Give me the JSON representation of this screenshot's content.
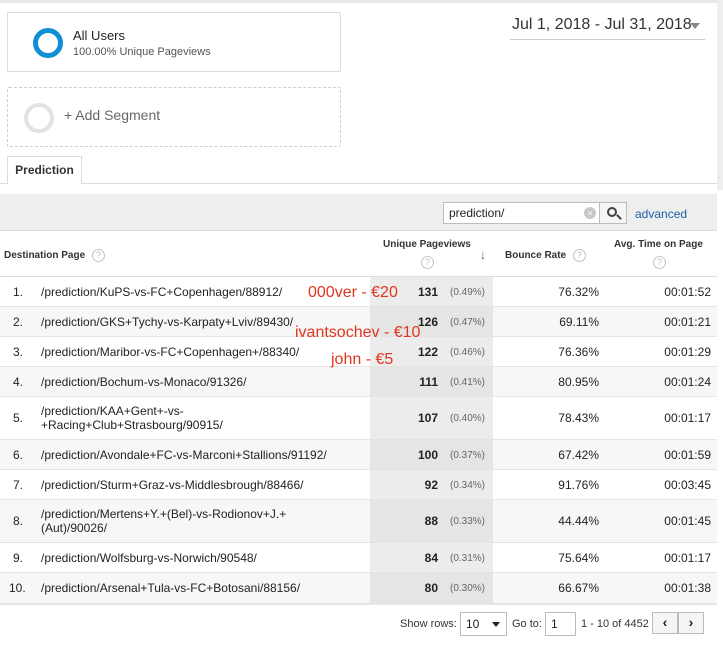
{
  "segments": {
    "active": {
      "title": "All Users",
      "subtitle": "100.00% Unique Pageviews",
      "color": "#0e8fd6"
    },
    "add_label": "+ Add Segment"
  },
  "date_range": {
    "label": "Jul 1, 2018 - Jul 31, 2018"
  },
  "tabs": [
    {
      "label": "Prediction",
      "selected": true
    }
  ],
  "filter": {
    "value": "prediction/",
    "advanced_label": "advanced"
  },
  "table": {
    "headers": {
      "page": "Destination Page",
      "unique_pageviews": "Unique Pageviews",
      "bounce_rate": "Bounce Rate",
      "avg_time": "Avg. Time on Page"
    },
    "sort": {
      "column": "unique_pageviews",
      "direction": "descending"
    },
    "rows": [
      {
        "num": "1.",
        "page": "/prediction/KuPS-vs-FC+Copenhagen/88912/",
        "pv": "131",
        "pct": "(0.49%)",
        "bounce": "76.32%",
        "avg": "00:01:52"
      },
      {
        "num": "2.",
        "page": "/prediction/GKS+Tychy-vs-Karpaty+Lviv/89430/",
        "pv": "126",
        "pct": "(0.47%)",
        "bounce": "69.11%",
        "avg": "00:01:21"
      },
      {
        "num": "3.",
        "page": "/prediction/Maribor-vs-FC+Copenhagen+/88340/",
        "pv": "122",
        "pct": "(0.46%)",
        "bounce": "76.36%",
        "avg": "00:01:29"
      },
      {
        "num": "4.",
        "page": "/prediction/Bochum-vs-Monaco/91326/",
        "pv": "111",
        "pct": "(0.41%)",
        "bounce": "80.95%",
        "avg": "00:01:24"
      },
      {
        "num": "5.",
        "page": "/prediction/KAA+Gent+-vs-+Racing+Club+Strasbourg/90915/",
        "pv": "107",
        "pct": "(0.40%)",
        "bounce": "78.43%",
        "avg": "00:01:17"
      },
      {
        "num": "6.",
        "page": "/prediction/Avondale+FC-vs-Marconi+Stallions/91192/",
        "pv": "100",
        "pct": "(0.37%)",
        "bounce": "67.42%",
        "avg": "00:01:59"
      },
      {
        "num": "7.",
        "page": "/prediction/Sturm+Graz-vs-Middlesbrough/88466/",
        "pv": "92",
        "pct": "(0.34%)",
        "bounce": "91.76%",
        "avg": "00:03:45"
      },
      {
        "num": "8.",
        "page": "/prediction/Mertens+Y.+(Bel)-vs-Rodionov+J.+(Aut)/90026/",
        "pv": "88",
        "pct": "(0.33%)",
        "bounce": "44.44%",
        "avg": "00:01:45"
      },
      {
        "num": "9.",
        "page": "/prediction/Wolfsburg-vs-Norwich/90548/",
        "pv": "84",
        "pct": "(0.31%)",
        "bounce": "75.64%",
        "avg": "00:01:17"
      },
      {
        "num": "10.",
        "page": "/prediction/Arsenal+Tula-vs-FC+Botosani/88156/",
        "pv": "80",
        "pct": "(0.30%)",
        "bounce": "66.67%",
        "avg": "00:01:38"
      }
    ]
  },
  "annotations": [
    {
      "text": "000ver - €20"
    },
    {
      "text": "ivantsochev - €10"
    },
    {
      "text": "john - €5"
    }
  ],
  "annotation_color": "#e0361e",
  "footer": {
    "show_rows_label": "Show rows:",
    "show_rows_value": "10",
    "goto_label": "Go to:",
    "goto_value": "1",
    "range_text": "1 - 10 of 4452",
    "prev_label": "‹",
    "next_label": "›"
  }
}
